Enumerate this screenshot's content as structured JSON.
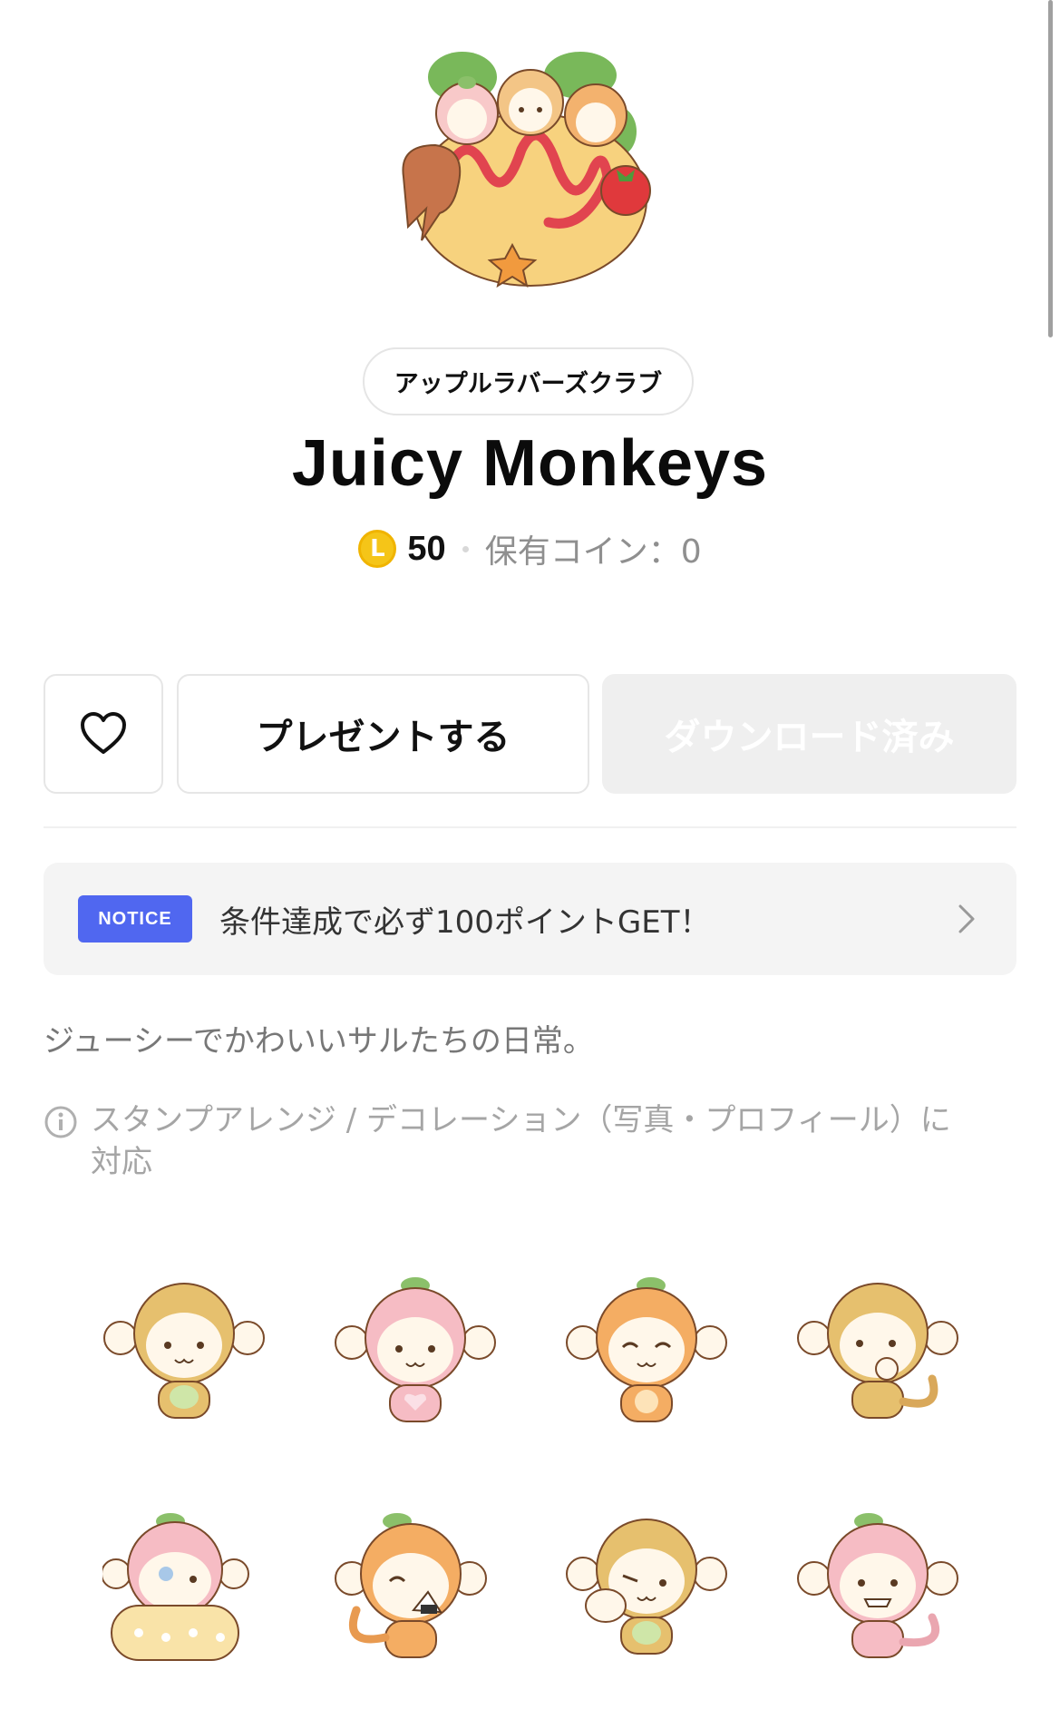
{
  "header": {
    "creator": "アップルラバーズクラブ",
    "title": "Juicy Monkeys"
  },
  "price": {
    "coin_letter": "L",
    "amount": "50",
    "owned_coins": "保有コイン：0"
  },
  "actions": {
    "favorite_icon": "heart-outline-icon",
    "present_label": "プレゼントする",
    "download_label": "ダウンロード済み"
  },
  "notice": {
    "badge": "NOTICE",
    "text": "条件達成で必ず100ポイントGET！"
  },
  "description": "ジューシーでかわいいサルたちの日常。",
  "info": {
    "text_line1": "スタンプアレンジ / デコレーション（写真・プロフィール）に",
    "text_line2": "対応"
  },
  "stickers": [
    {
      "name": "sticker-yellow-monkey-standing"
    },
    {
      "name": "sticker-peach-monkey-standing"
    },
    {
      "name": "sticker-orange-monkey-happy"
    },
    {
      "name": "sticker-yellow-monkey-thinking"
    },
    {
      "name": "sticker-peach-monkey-sleeping"
    },
    {
      "name": "sticker-orange-monkey-eating"
    },
    {
      "name": "sticker-yellow-monkey-wink"
    },
    {
      "name": "sticker-peach-monkey-grin"
    }
  ],
  "colors": {
    "accent_notice": "#5067f0",
    "coin": "#f5c518",
    "disabled_button": "#efefef"
  }
}
